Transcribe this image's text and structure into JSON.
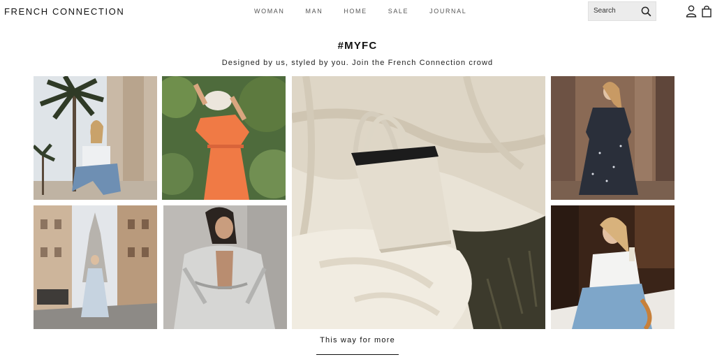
{
  "header": {
    "logo": "FRENCH CONNECTION",
    "nav": [
      "WOMAN",
      "MAN",
      "HOME",
      "SALE",
      "JOURNAL"
    ],
    "search_placeholder": "Search"
  },
  "hero": {
    "title": "#MYFC",
    "subtitle": "Designed by us, styled by you. Join the French Connection crowd"
  },
  "gallery": {
    "more_link": "This way for more"
  }
}
